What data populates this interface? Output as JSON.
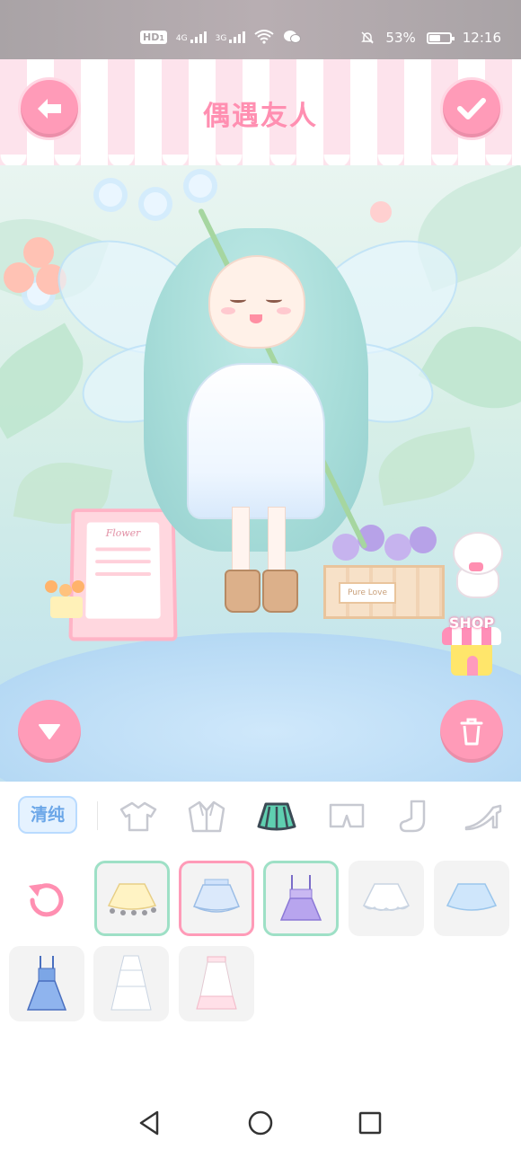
{
  "status_bar": {
    "hd": "HD",
    "sim": "1",
    "net1": "4G",
    "net2": "3G",
    "battery": "53%",
    "battery_level": 0.53,
    "time": "12:16"
  },
  "header": {
    "title": "偶遇友人"
  },
  "scene": {
    "sign_text": "Flower",
    "crate_text": "Pure Love",
    "shop_label": "SHOP"
  },
  "panel": {
    "style_label": "清纯",
    "categories": [
      "tshirt-icon",
      "jacket-icon",
      "skirt-icon",
      "shorts-icon",
      "sock-icon",
      "heel-icon"
    ],
    "selected_category": "skirt-icon",
    "items": [
      {
        "name": "yellow-tutu-skirt",
        "state": "selected-green"
      },
      {
        "name": "blue-layered-skirt",
        "state": "selected-pink"
      },
      {
        "name": "purple-overall-skirt",
        "state": "selected-green"
      },
      {
        "name": "white-lace-skirt",
        "state": "normal"
      },
      {
        "name": "blue-flare-skirt",
        "state": "normal"
      },
      {
        "name": "blue-pinafore-dress",
        "state": "normal"
      },
      {
        "name": "white-tiered-long-skirt",
        "state": "normal"
      },
      {
        "name": "white-pink-long-skirt",
        "state": "normal"
      }
    ]
  },
  "colors": {
    "pink_accent": "#ff9bb8",
    "title_pink": "#ff8fb1",
    "style_blue": "#6aa6e8",
    "tile_bg": "#f3f3f3"
  }
}
